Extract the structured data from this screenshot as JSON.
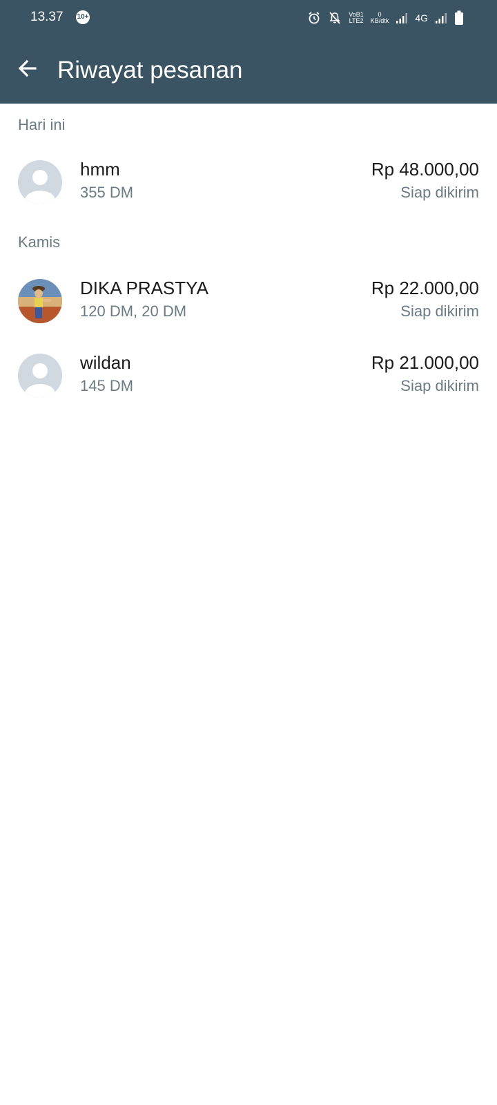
{
  "status_bar": {
    "time": "13.37",
    "notification_badge": "10+",
    "volte_label_top": "VoB1",
    "volte_label_bottom": "LTE2",
    "speed_value": "0",
    "speed_unit": "KB/dtk",
    "network_label": "4G",
    "icons": [
      "alarm-icon",
      "mute-icon",
      "signal-icon",
      "signal-icon",
      "battery-icon"
    ]
  },
  "header": {
    "title": "Riwayat pesanan",
    "back_icon": "arrow-left-icon"
  },
  "colors": {
    "header_bg": "#3b5463",
    "secondary_text": "#6a7b86",
    "avatar_placeholder": "#d1d9e0"
  },
  "sections": [
    {
      "title": "Hari ini",
      "orders": [
        {
          "name": "hmm",
          "items": "355 DM",
          "price": "Rp 48.000,00",
          "status": "Siap dikirim",
          "avatar": "default-avatar"
        }
      ]
    },
    {
      "title": "Kamis",
      "orders": [
        {
          "name": "DIKA PRASTYA",
          "items": "120 DM, 20 DM",
          "price": "Rp 22.000,00",
          "status": "Siap dikirim",
          "avatar": "photo-avatar"
        },
        {
          "name": "wildan",
          "items": "145 DM",
          "price": "Rp 21.000,00",
          "status": "Siap dikirim",
          "avatar": "default-avatar"
        }
      ]
    }
  ]
}
